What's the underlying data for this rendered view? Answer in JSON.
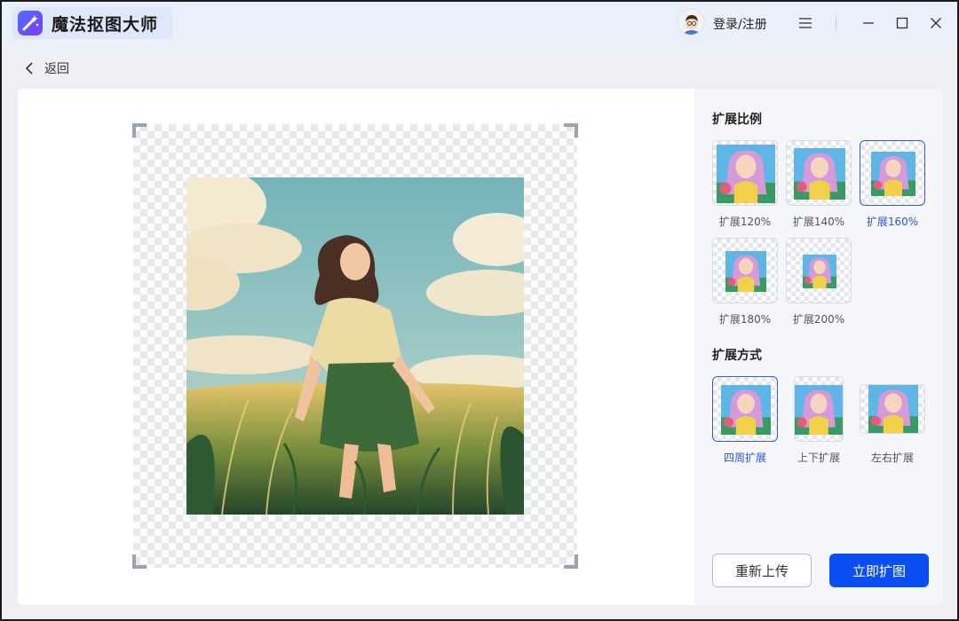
{
  "app": {
    "title": "魔法抠图大师"
  },
  "header": {
    "login_label": "登录/注册"
  },
  "nav": {
    "back_label": "返回"
  },
  "ratio_section": {
    "title": "扩展比例",
    "options": [
      {
        "label": "扩展120%",
        "selected": false
      },
      {
        "label": "扩展140%",
        "selected": false
      },
      {
        "label": "扩展160%",
        "selected": true
      },
      {
        "label": "扩展180%",
        "selected": false
      },
      {
        "label": "扩展200%",
        "selected": false
      }
    ]
  },
  "mode_section": {
    "title": "扩展方式",
    "options": [
      {
        "label": "四周扩展",
        "selected": true
      },
      {
        "label": "上下扩展",
        "selected": false
      },
      {
        "label": "左右扩展",
        "selected": false
      }
    ]
  },
  "actions": {
    "reupload_label": "重新上传",
    "expand_label": "立即扩图"
  },
  "colors": {
    "accent": "#0b4ff2",
    "selected_border": "#3b5bd6",
    "selected_text": "#2f55d4"
  },
  "icons": [
    "logo-icon",
    "avatar-icon",
    "menu-icon",
    "minimize-icon",
    "maximize-icon",
    "close-icon",
    "back-chevron-icon"
  ]
}
